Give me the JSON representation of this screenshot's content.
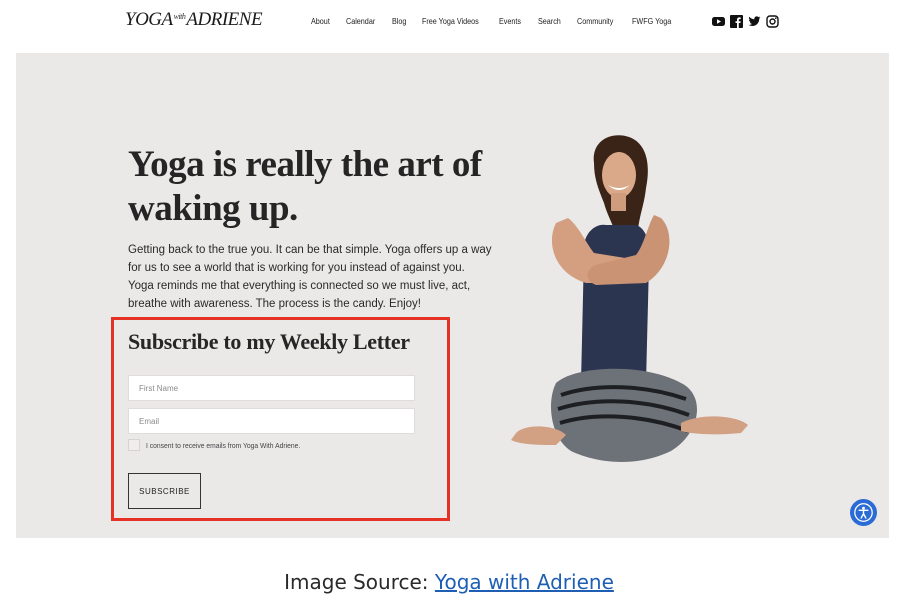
{
  "header": {
    "logo_main": "YOGA",
    "logo_with": "with",
    "logo_name": "ADRIENE",
    "nav": [
      "About",
      "Calendar",
      "Blog",
      "Free Yoga Videos",
      "Events",
      "Search",
      "Community",
      "FWFG Yoga"
    ],
    "social_icons": [
      "youtube-icon",
      "facebook-icon",
      "twitter-icon",
      "instagram-icon"
    ]
  },
  "hero": {
    "headline": "Yoga is really the art of waking up.",
    "intro": "Getting back to the true you. It can be that simple. Yoga offers up a way for us to see a world that is working for you instead of against you. Yoga reminds me that everything is connected so we must live, act, breathe with awareness. The process is the candy. Enjoy!"
  },
  "subscribe": {
    "title": "Subscribe to my Weekly Letter",
    "first_name_placeholder": "First Name",
    "email_placeholder": "Email",
    "consent": "I consent to receive emails from Yoga With Adriene.",
    "button": "SUBSCRIBE",
    "highlight_color": "#e53225"
  },
  "caption": {
    "prefix": "Image Source: ",
    "link": "Yoga with Adriene"
  },
  "colors": {
    "hero_bg": "#ebe8e8",
    "accessibility_button": "#2a6bd6",
    "link": "#1e5fb5"
  }
}
